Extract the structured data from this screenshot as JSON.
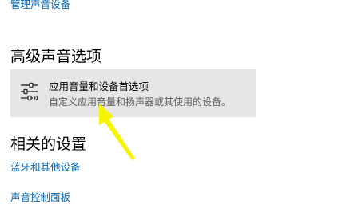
{
  "top_link": {
    "label": "管理声音设备"
  },
  "advanced_section": {
    "heading": "高级声音选项",
    "option": {
      "icon": "sliders-icon",
      "title": "应用音量和设备首选项",
      "description": "自定义应用音量和扬声器或其使用的设备。"
    }
  },
  "related_section": {
    "heading": "相关的设置",
    "links": [
      {
        "label": "蓝牙和其他设备"
      },
      {
        "label": "声音控制面板"
      }
    ]
  },
  "colors": {
    "link": "#0066b4",
    "card_background": "#e6e6e6",
    "annotation_arrow": "#f5f500"
  }
}
